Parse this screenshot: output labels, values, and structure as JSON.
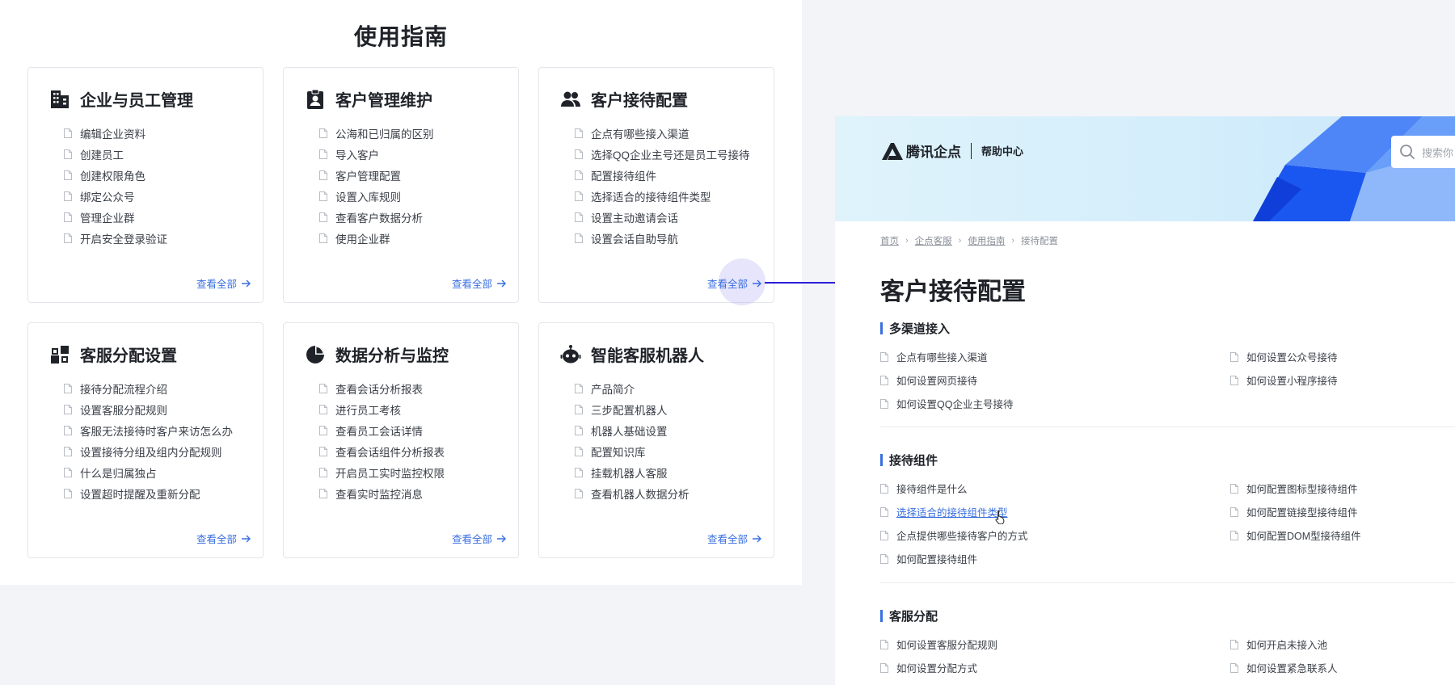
{
  "guide": {
    "title": "使用指南",
    "view_all_label": "查看全部",
    "cards": [
      {
        "title": "企业与员工管理",
        "icon": "building-icon",
        "items": [
          "编辑企业资料",
          "创建员工",
          "创建权限角色",
          "绑定公众号",
          "管理企业群",
          "开启安全登录验证"
        ]
      },
      {
        "title": "客户管理维护",
        "icon": "contact-badge-icon",
        "items": [
          "公海和已归属的区别",
          "导入客户",
          "客户管理配置",
          "设置入库规则",
          "查看客户数据分析",
          "使用企业群"
        ]
      },
      {
        "title": "客户接待配置",
        "icon": "people-icon",
        "items": [
          "企点有哪些接入渠道",
          "选择QQ企业主号还是员工号接待",
          "配置接待组件",
          "选择适合的接待组件类型",
          "设置主动邀请会话",
          "设置会话自助导航"
        ]
      },
      {
        "title": "客服分配设置",
        "icon": "distribution-icon",
        "items": [
          "接待分配流程介绍",
          "设置客服分配规则",
          "客服无法接待时客户来访怎么办",
          "设置接待分组及组内分配规则",
          "什么是归属独占",
          "设置超时提醒及重新分配"
        ]
      },
      {
        "title": "数据分析与监控",
        "icon": "pie-chart-icon",
        "items": [
          "查看会话分析报表",
          "进行员工考核",
          "查看员工会话详情",
          "查看会话组件分析报表",
          "开启员工实时监控权限",
          "查看实时监控消息"
        ]
      },
      {
        "title": "智能客服机器人",
        "icon": "robot-icon",
        "items": [
          "产品简介",
          "三步配置机器人",
          "机器人基础设置",
          "配置知识库",
          "挂载机器人客服",
          "查看机器人数据分析"
        ]
      }
    ]
  },
  "help": {
    "brand_name": "腾讯企点",
    "brand_sub": "帮助中心",
    "search_placeholder": "搜索你",
    "breadcrumb": [
      "首页",
      "企点客服",
      "使用指南",
      "接待配置"
    ],
    "page_title": "客户接待配置",
    "sections": [
      {
        "title": "多渠道接入",
        "links": [
          "企点有哪些接入渠道",
          "如何设置公众号接待",
          "如何设置网页接待",
          "如何设置小程序接待",
          "如何设置QQ企业主号接待"
        ]
      },
      {
        "title": "接待组件",
        "links": [
          "接待组件是什么",
          "如何配置图标型接待组件",
          "选择适合的接待组件类型",
          "如何配置链接型接待组件",
          "企点提供哪些接待客户的方式",
          "如何配置DOM型接待组件",
          "如何配置接待组件"
        ]
      },
      {
        "title": "客服分配",
        "links": [
          "如何设置客服分配规则",
          "如何开启未接入池",
          "如何设置分配方式",
          "如何设置紧急联系人"
        ]
      }
    ]
  },
  "colors": {
    "accent": "#3a6fe0",
    "connector": "#2a1fd6",
    "highlight": "#b4a8f0"
  }
}
